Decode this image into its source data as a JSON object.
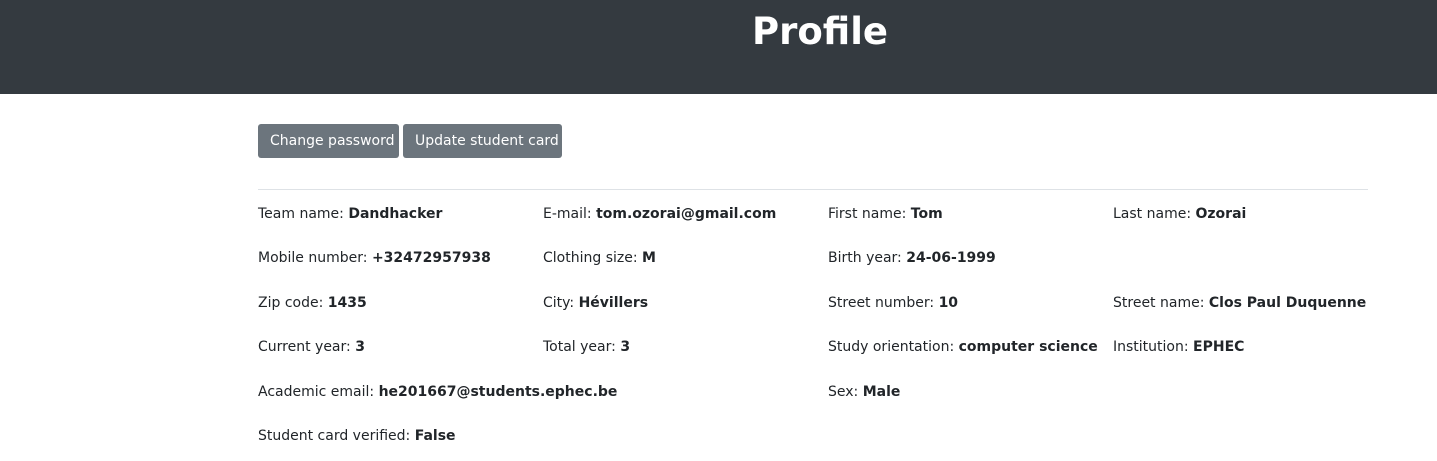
{
  "header": {
    "title": "Profile"
  },
  "actions": {
    "change_password": "Change password",
    "update_student_card": "Update student card"
  },
  "fields": {
    "team_name": {
      "label": "Team name:",
      "value": "Dandhacker"
    },
    "email": {
      "label": "E-mail:",
      "value": "tom.ozorai@gmail.com"
    },
    "first_name": {
      "label": "First name:",
      "value": "Tom"
    },
    "last_name": {
      "label": "Last name:",
      "value": "Ozorai"
    },
    "mobile_number": {
      "label": "Mobile number:",
      "value": "+32472957938"
    },
    "clothing_size": {
      "label": "Clothing size:",
      "value": "M"
    },
    "birth_year": {
      "label": "Birth year:",
      "value": "24-06-1999"
    },
    "zip_code": {
      "label": "Zip code:",
      "value": "1435"
    },
    "city": {
      "label": "City:",
      "value": "Hévillers"
    },
    "street_number": {
      "label": "Street number:",
      "value": "10"
    },
    "street_name": {
      "label": "Street name:",
      "value": "Clos Paul Duquenne"
    },
    "current_year": {
      "label": "Current year:",
      "value": "3"
    },
    "total_year": {
      "label": "Total year:",
      "value": "3"
    },
    "study_orientation": {
      "label": "Study orientation:",
      "value": "computer science"
    },
    "institution": {
      "label": "Institution:",
      "value": "EPHEC"
    },
    "academic_email": {
      "label": "Academic email:",
      "value": "he201667@students.ephec.be"
    },
    "sex": {
      "label": "Sex:",
      "value": "Male"
    },
    "student_card_verified": {
      "label": "Student card verified:",
      "value": "False"
    }
  },
  "colors": {
    "header_bg": "#343a40",
    "button_bg": "#6c757d",
    "text": "#212529"
  }
}
